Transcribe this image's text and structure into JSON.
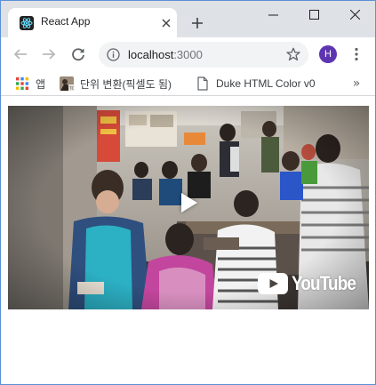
{
  "browser": {
    "tab": {
      "title": "React App"
    },
    "url": {
      "host": "localhost",
      "port": ":3000"
    },
    "profile_initial": "H",
    "accent": "#5e35b1",
    "bookmarks": [
      {
        "label": "앱",
        "icon": "apps-grid-icon"
      },
      {
        "label": "단위 변환(픽셀도 됨)",
        "icon": "bookmark-thumbnail-icon"
      },
      {
        "label": "Duke HTML Color v0",
        "icon": "page-icon"
      }
    ],
    "more_label": "»"
  },
  "video": {
    "provider_label": "YouTube",
    "play_icon": "play-icon",
    "brand_color": "#ffffff"
  }
}
